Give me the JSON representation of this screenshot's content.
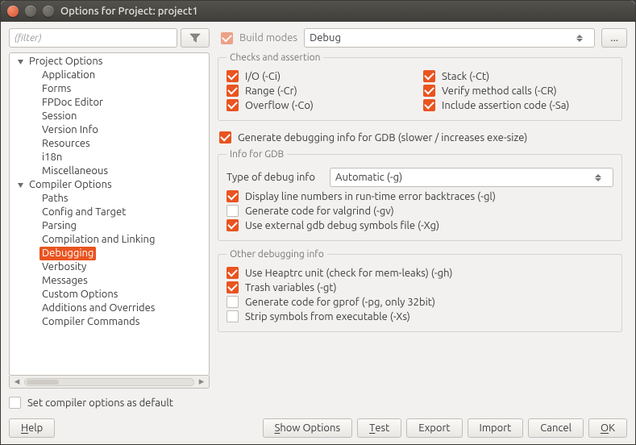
{
  "window": {
    "title": "Options for Project: project1"
  },
  "filter": {
    "placeholder": "(filter)"
  },
  "build_modes": {
    "label": "Build modes",
    "selected": "Debug",
    "more_button": "..."
  },
  "tree": {
    "groups": [
      {
        "label": "Project Options",
        "items": [
          "Application",
          "Forms",
          "FPDoc Editor",
          "Session",
          "Version Info",
          "Resources",
          "i18n",
          "Miscellaneous"
        ]
      },
      {
        "label": "Compiler Options",
        "items": [
          "Paths",
          "Config and Target",
          "Parsing",
          "Compilation and Linking",
          "Debugging",
          "Verbosity",
          "Messages",
          "Custom Options",
          "Additions and Overrides",
          "Compiler Commands"
        ],
        "selected": "Debugging"
      }
    ]
  },
  "checks_assertion": {
    "legend": "Checks and assertion",
    "io": "I/O (-Ci)",
    "range": "Range (-Cr)",
    "overflow": "Overflow (-Co)",
    "stack": "Stack (-Ct)",
    "verify": "Verify method calls (-CR)",
    "assert": "Include assertion code (-Sa)"
  },
  "gdb": {
    "generate": "Generate debugging info for GDB (slower / increases exe-size)",
    "legend": "Info for GDB",
    "type_label": "Type of debug info",
    "type_value": "Automatic (-g)",
    "linenum": "Display line numbers in run-time error backtraces (-gl)",
    "valgrind": "Generate code for valgrind (-gv)",
    "ext_sym": "Use external gdb debug symbols file (-Xg)"
  },
  "other": {
    "legend": "Other debugging info",
    "heaptrc": "Use Heaptrc unit (check for mem-leaks) (-gh)",
    "trash": "Trash variables (-gt)",
    "gprof": "Generate code for gprof (-pg, only 32bit)",
    "strip": "Strip symbols from executable (-Xs)"
  },
  "set_default": "Set compiler options as default",
  "footer": {
    "help": "Help",
    "show_options": "Show Options",
    "test": "Test",
    "export": "Export",
    "import": "Import",
    "cancel": "Cancel",
    "ok": "OK"
  }
}
